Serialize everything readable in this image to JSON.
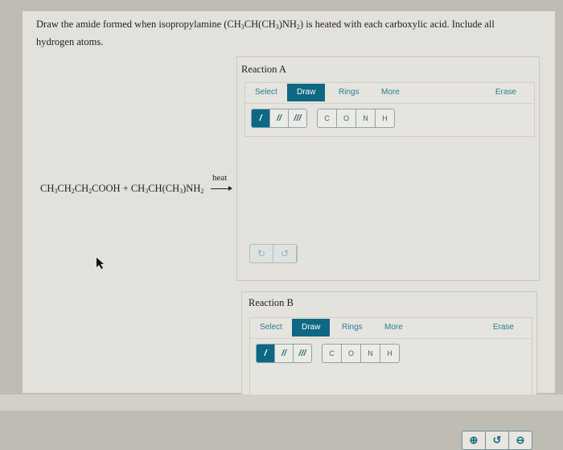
{
  "question": {
    "line1_pre": "Draw the amide formed when isopropylamine (CH",
    "sub1": "3",
    "mid1": "CH(CH",
    "sub2": "3",
    "mid2": ")NH",
    "sub3": "2",
    "line1_post": ") is heated with each carboxylic acid. Include all hydrogen atoms."
  },
  "equation": {
    "parts": [
      "CH",
      "3",
      "CH",
      "2",
      "CH",
      "2",
      "COOH + CH",
      "3",
      "CH(CH",
      "3",
      ")NH",
      "2"
    ],
    "arrow_label": "heat"
  },
  "reactions": [
    {
      "title": "Reaction A",
      "tabs": [
        "Select",
        "Draw",
        "Rings",
        "More"
      ],
      "active_tab": "Draw",
      "erase_label": "Erase",
      "bonds": [
        "/",
        "//",
        "///"
      ],
      "atoms": [
        "C",
        "O",
        "N",
        "H"
      ],
      "history": {
        "undo_icon": "↻",
        "redo_icon": "↺"
      },
      "zoom": {
        "zoom_in_icon": "⊕",
        "reset_icon": "↺",
        "zoom_out_icon": "⊖"
      }
    },
    {
      "title": "Reaction B",
      "tabs": [
        "Select",
        "Draw",
        "Rings",
        "More"
      ],
      "active_tab": "Draw",
      "erase_label": "Erase",
      "bonds": [
        "/",
        "//",
        "///"
      ],
      "atoms": [
        "C",
        "O",
        "N",
        "H"
      ]
    }
  ],
  "colors": {
    "accent": "#0e6783",
    "link": "#2a7c93"
  }
}
